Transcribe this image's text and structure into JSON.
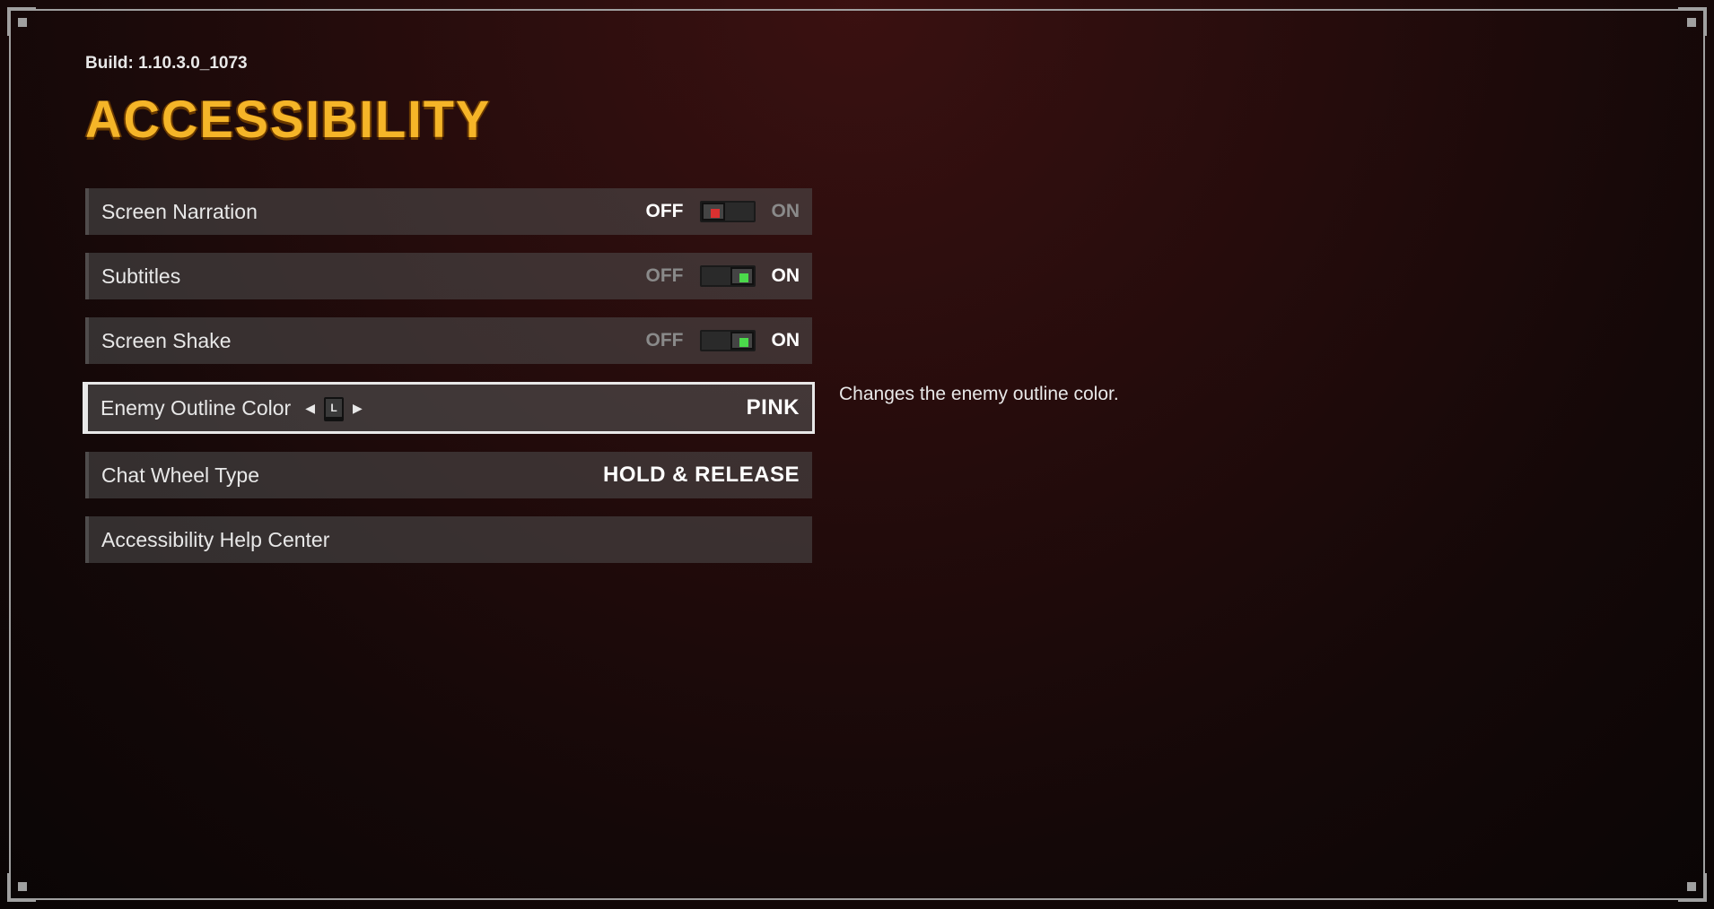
{
  "build_label": "Build: 1.10.3.0_1073",
  "page_title": "ACCESSIBILITY",
  "toggle": {
    "off": "OFF",
    "on": "ON"
  },
  "options": {
    "screen_narration": {
      "label": "Screen Narration",
      "state": "off"
    },
    "subtitles": {
      "label": "Subtitles",
      "state": "on"
    },
    "screen_shake": {
      "label": "Screen Shake",
      "state": "on"
    },
    "enemy_outline": {
      "label": "Enemy Outline Color",
      "stick": "L",
      "value": "PINK",
      "description": "Changes the enemy outline color."
    },
    "chat_wheel": {
      "label": "Chat Wheel Type",
      "value": "HOLD & RELEASE"
    },
    "help_center": {
      "label": "Accessibility Help Center"
    }
  },
  "selected_option": "enemy_outline"
}
